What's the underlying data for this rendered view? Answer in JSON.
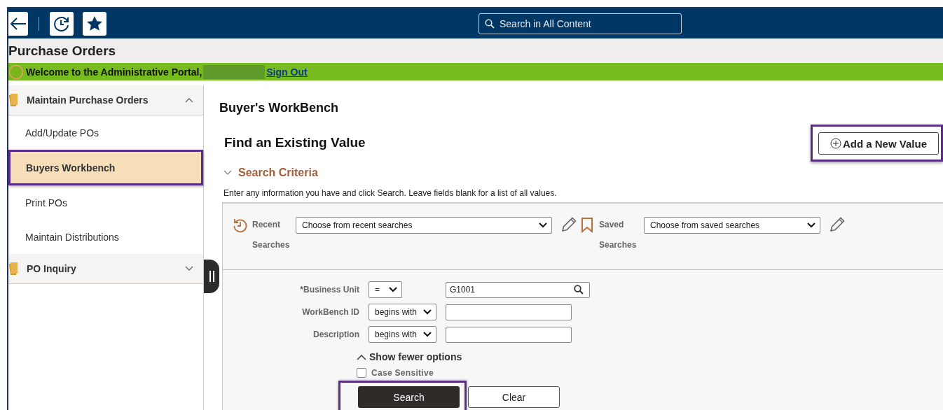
{
  "header": {
    "search": {
      "placeholder": "Search in All Content"
    }
  },
  "page_title": "Purchase Orders",
  "banner": {
    "welcome": "Welcome to the Administrative Portal,",
    "link": "Sign Out"
  },
  "sidebar": {
    "groups": [
      {
        "label": "Maintain Purchase Orders",
        "expanded": true,
        "children": [
          {
            "label": "Add/Update POs",
            "selected": false,
            "highlighted": false
          },
          {
            "label": "Buyers Workbench",
            "selected": true,
            "highlighted": true
          },
          {
            "label": "Print POs",
            "selected": false,
            "highlighted": false
          },
          {
            "label": "Maintain Distributions",
            "selected": false,
            "highlighted": false
          }
        ]
      },
      {
        "label": "PO Inquiry",
        "expanded": false
      }
    ]
  },
  "main": {
    "title": "Buyer's WorkBench",
    "heading": "Find an Existing Value",
    "add_button": {
      "label": "Add a New Value",
      "highlighted": true
    },
    "section": {
      "label": "Search Criteria",
      "expanded": true
    },
    "instructions": "Enter any information you have and click Search. Leave fields blank for a list of all values.",
    "recent": {
      "label": "Recent Searches",
      "value": "Choose from recent searches"
    },
    "saved": {
      "label": "Saved Searches",
      "value": "Choose from saved searches"
    },
    "criteria": [
      {
        "label": "*Business Unit",
        "operator": "=",
        "value": "G1001",
        "kind": "lookup"
      },
      {
        "label": "WorkBench ID",
        "operator": "begins with",
        "kind": "text"
      },
      {
        "label": "Description",
        "operator": "begins with",
        "kind": "text"
      }
    ],
    "options_link": "Show fewer options",
    "case_sensitive": {
      "label": "Case Sensitive",
      "checked": false
    },
    "buttons": [
      {
        "label": "Search",
        "kind": "primary",
        "highlighted": true
      },
      {
        "label": "Clear",
        "kind": "secondary",
        "highlighted": false
      }
    ]
  }
}
